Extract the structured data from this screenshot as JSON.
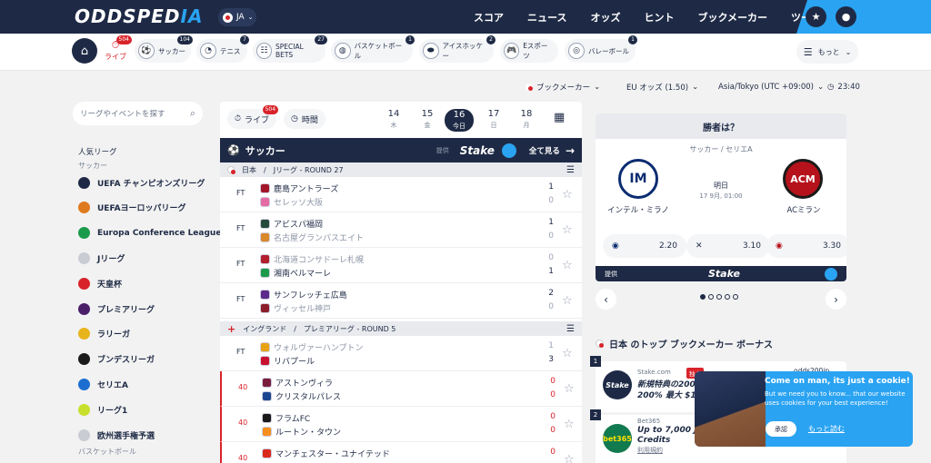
{
  "header": {
    "logo_main": "ODDSPED",
    "logo_accent": "IA",
    "lang": "JA",
    "nav": [
      "スコア",
      "ニュース",
      "オッズ",
      "ヒント",
      "ブックメーカー",
      "ツール"
    ]
  },
  "sports_bar": {
    "live": {
      "label": "ライブ",
      "count": "504"
    },
    "items": [
      {
        "label": "サッカー",
        "count": "104",
        "icon": "⚽"
      },
      {
        "label": "テニス",
        "count": "7",
        "icon": "◔"
      },
      {
        "label": "SPECIAL BETS",
        "count": "27",
        "icon": "☷"
      },
      {
        "label": "バスケットボール",
        "count": "1",
        "icon": "◍"
      },
      {
        "label": "アイスホッケー",
        "count": "2",
        "icon": "⬬"
      },
      {
        "label": "Eスポーツ",
        "count": "",
        "icon": "🎮"
      },
      {
        "label": "バレーボール",
        "count": "1",
        "icon": "◎"
      }
    ],
    "more": "もっと"
  },
  "filters": {
    "bookmaker": "ブックメーカー",
    "odds_format": "EU オッズ (1.50)",
    "timezone": "Asia/Tokyo (UTC +09:00)",
    "time": "23:40"
  },
  "sidebar": {
    "search_placeholder": "リーグやイベントを探す",
    "popular": "人気リーグ",
    "football": "サッカー",
    "leagues": [
      {
        "name": "UEFA チャンピオンズリーグ",
        "color": "#1e2a45"
      },
      {
        "name": "UEFAヨーロッパリーグ",
        "color": "#e07a1f"
      },
      {
        "name": "Europa Conference League",
        "color": "#1c9a4b"
      },
      {
        "name": "Jリーグ",
        "color": "#c9ccd3"
      },
      {
        "name": "天皇杯",
        "color": "#d8232a"
      },
      {
        "name": "プレミアリーグ",
        "color": "#4b1f68"
      },
      {
        "name": "ラリーガ",
        "color": "#e8b41c"
      },
      {
        "name": "ブンデスリーガ",
        "color": "#1a1a1a"
      },
      {
        "name": "セリエA",
        "color": "#1c6fd1"
      },
      {
        "name": "リーグ1",
        "color": "#c8e02b"
      },
      {
        "name": "欧州選手権予選",
        "color": "#c9ccd3"
      }
    ],
    "basketball": "バスケットボール"
  },
  "matches_panel": {
    "live_label": "ライブ",
    "live_count": "504",
    "time_label": "時間",
    "days": [
      {
        "num": "14",
        "wd": "木"
      },
      {
        "num": "15",
        "wd": "金"
      },
      {
        "num": "16",
        "wd": "今日"
      },
      {
        "num": "17",
        "wd": "日"
      },
      {
        "num": "18",
        "wd": "月"
      }
    ],
    "sport_title": "サッカー",
    "provided_by": "提供",
    "sponsor": "Stake",
    "see_all": "全て見る",
    "league1": {
      "country": "日本",
      "name": "Jリーグ - ROUND 27"
    },
    "league2": {
      "country": "イングランド",
      "name": "プレミアリーグ - ROUND 5"
    },
    "matches": [
      {
        "status": "FT",
        "home": "鹿島アントラーズ",
        "away": "セレッソ大阪",
        "hs": "1",
        "as": "0",
        "dim": "away",
        "hc": "#a3162a",
        "ac": "#e56ba5"
      },
      {
        "status": "FT",
        "home": "アビスパ福岡",
        "away": "名古屋グランパスエイト",
        "hs": "1",
        "as": "0",
        "dim": "away",
        "hc": "#244a3c",
        "ac": "#d9882a"
      },
      {
        "status": "FT",
        "home": "北海道コンサドーレ札幌",
        "away": "湘南ベルマーレ",
        "hs": "0",
        "as": "1",
        "dim": "home",
        "hc": "#b21e2e",
        "ac": "#1c9a4b"
      },
      {
        "status": "FT",
        "home": "サンフレッチェ広島",
        "away": "ヴィッセル神戸",
        "hs": "2",
        "as": "0",
        "dim": "away",
        "hc": "#5b2a8a",
        "ac": "#8c1d2a"
      },
      {
        "status": "FT",
        "home": "ウォルヴァーハンプトン",
        "away": "リバプール",
        "hs": "1",
        "as": "3",
        "dim": "home",
        "hc": "#e8a314",
        "ac": "#c8102e"
      },
      {
        "status": "40",
        "home": "アストンヴィラ",
        "away": "クリスタルパレス",
        "hs": "0",
        "as": "0",
        "dim": "",
        "hc": "#7a1c3c",
        "ac": "#1b458f"
      },
      {
        "status": "40",
        "home": "フラムFC",
        "away": "ルートン・タウン",
        "hs": "0",
        "as": "0",
        "dim": "",
        "hc": "#1a1a1a",
        "ac": "#f78f1e"
      },
      {
        "status": "40",
        "home": "マンチェスター・ユナイテッド",
        "away": "",
        "hs": "0",
        "as": "",
        "dim": "",
        "hc": "#da291c",
        "ac": "#ffffff"
      }
    ]
  },
  "winner_widget": {
    "title": "勝者は？",
    "league": "サッカー / セリエA",
    "when": "明日",
    "datetime": "17 9月, 01:00",
    "home": "インテル・ミラノ",
    "away": "ACミラン",
    "odds": {
      "home": "2.20",
      "draw": "3.10",
      "away": "3.30"
    },
    "provided_by": "提供",
    "sponsor": "Stake"
  },
  "bonus": {
    "title": "日本 のトップ ブックメーカー ボーナス",
    "cards": [
      {
        "rank": "1",
        "site": "Stake.com",
        "tag": "独占",
        "offer_line1": "新規特典の200%",
        "offer_line2": "200% 最大 $10",
        "code": "odds200jp",
        "logo": "Stake",
        "logo_bg": "#1e2a45",
        "logo_fg": "#ffffff"
      },
      {
        "rank": "2",
        "site": "Bet365",
        "offer_line1": "Up to 7,000 JP",
        "offer_line2": "Credits",
        "terms": "利用規約",
        "logo": "bet365",
        "logo_bg": "#127a4f",
        "logo_fg": "#ffe200"
      }
    ]
  },
  "cookie": {
    "title": "Come on man, its just a cookie!",
    "text": "But we need you to know... that our website uses cookies for your best experience!",
    "accept": "承認",
    "more": "もっと読む"
  }
}
